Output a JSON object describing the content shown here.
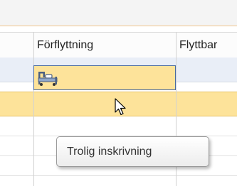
{
  "columns": [
    {
      "label": ""
    },
    {
      "label": "Förflyttning"
    },
    {
      "label": "Flyttbar"
    }
  ],
  "selected_row": {
    "icon": "bed-icon"
  },
  "tooltip": {
    "text": "Trolig inskrivning"
  },
  "colors": {
    "selection_fill": "#fde39a",
    "selection_border": "#e8c366",
    "focus_cell_border": "#4a6aa0",
    "alt_row_blue": "#e9eef7",
    "toolbar_accent_line": "#f0c48a"
  }
}
